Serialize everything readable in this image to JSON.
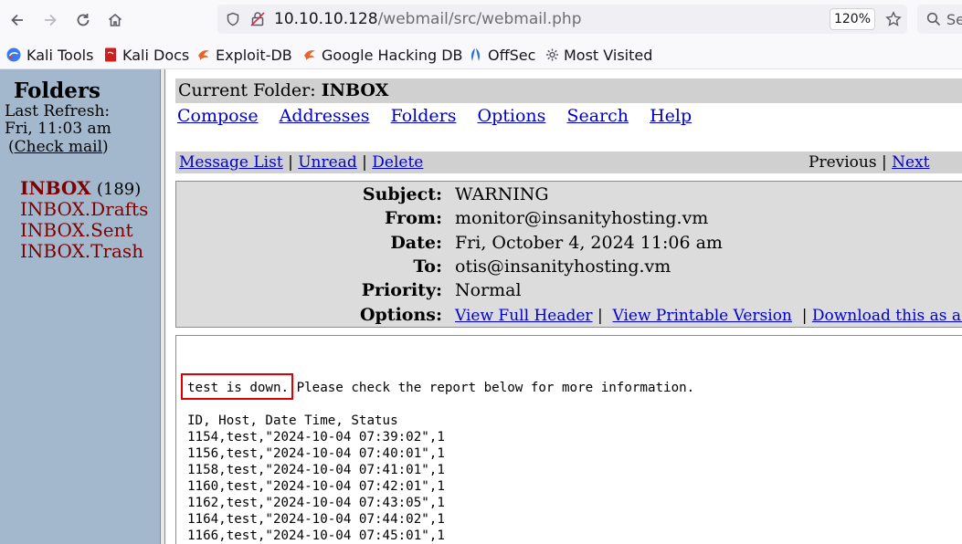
{
  "browser": {
    "url_host": "10.10.10.128",
    "url_path": "/webmail/src/webmail.php",
    "zoom": "120%",
    "search_placeholder": "Se",
    "bookmarks": [
      {
        "label": "Kali Tools",
        "icon": "kali-icon"
      },
      {
        "label": "Kali Docs",
        "icon": "kali-docs-icon"
      },
      {
        "label": "Exploit-DB",
        "icon": "exploit-db-icon"
      },
      {
        "label": "Google Hacking DB",
        "icon": "ghdb-icon"
      },
      {
        "label": "OffSec",
        "icon": "offsec-icon"
      },
      {
        "label": "Most Visited",
        "icon": "gear-icon"
      }
    ]
  },
  "sidebar": {
    "title": "Folders",
    "last_refresh_label": "Last Refresh:",
    "last_refresh_time": "Fri, 11:03 am",
    "check_mail": "Check mail",
    "folders": [
      {
        "name": "INBOX",
        "count": "(189)"
      },
      {
        "name": "INBOX.Drafts"
      },
      {
        "name": "INBOX.Sent"
      },
      {
        "name": "INBOX.Trash"
      }
    ]
  },
  "main": {
    "current_folder_label": "Current Folder:",
    "current_folder": "INBOX",
    "menu": [
      "Compose",
      "Addresses",
      "Folders",
      "Options",
      "Search",
      "Help"
    ],
    "nav": {
      "message_list": "Message List",
      "unread": "Unread",
      "delete": "Delete",
      "previous": "Previous",
      "next": "Next"
    },
    "headers": {
      "subject_label": "Subject:",
      "subject": "WARNING",
      "from_label": "From:",
      "from": "monitor@insanityhosting.vm",
      "date_label": "Date:",
      "date": "Fri, October 4, 2024 11:06 am",
      "to_label": "To:",
      "to": "otis@insanityhosting.vm",
      "priority_label": "Priority:",
      "priority": "Normal",
      "options_label": "Options:",
      "view_full_header": "View Full Header",
      "view_printable": "View Printable Version",
      "download": "Download this as a file"
    },
    "body": {
      "highlighted": "test is down.",
      "line1_rest": " Please check the report below for more information.",
      "table_header": "ID, Host, Date Time, Status",
      "rows": [
        "1154,test,\"2024-10-04 07:39:02\",1",
        "1156,test,\"2024-10-04 07:40:01\",1",
        "1158,test,\"2024-10-04 07:41:01\",1",
        "1160,test,\"2024-10-04 07:42:01\",1",
        "1162,test,\"2024-10-04 07:43:05\",1",
        "1164,test,\"2024-10-04 07:44:02\",1",
        "1166,test,\"2024-10-04 07:45:01\",1"
      ]
    }
  }
}
